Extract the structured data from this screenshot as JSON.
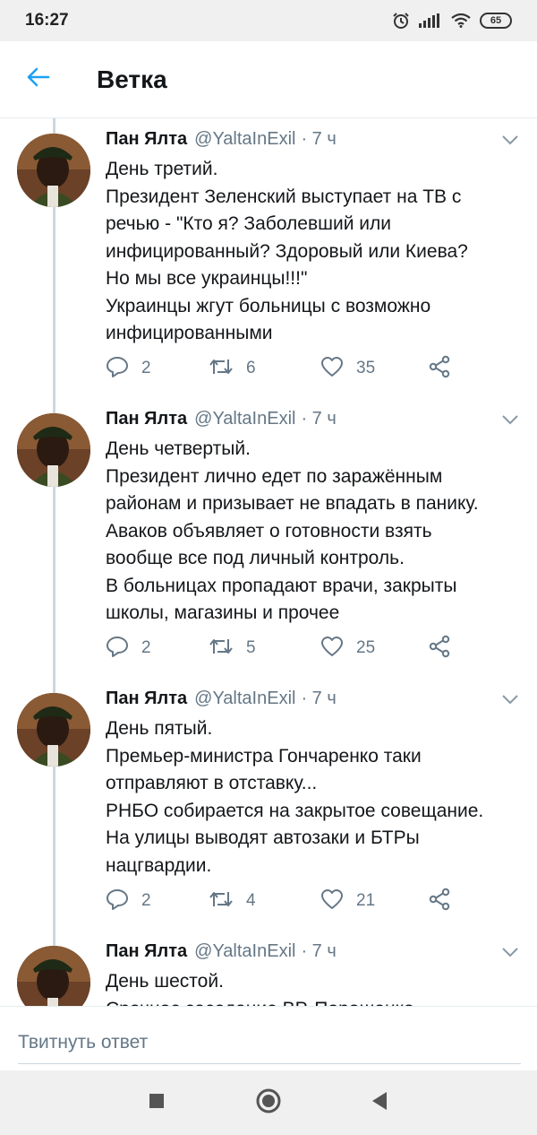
{
  "status_bar": {
    "time": "16:27",
    "battery": "65",
    "icons": [
      "alarm-icon",
      "signal-icon",
      "wifi-icon",
      "battery-icon"
    ]
  },
  "header": {
    "title": "Ветка",
    "back_icon": "arrow-left-icon"
  },
  "colors": {
    "accent": "#1da1f2",
    "secondary_text": "#657786",
    "thread_line": "#ccd6dd"
  },
  "tweets": [
    {
      "name": "Пан Ялта",
      "handle": "@YaltaInExil",
      "time": "· 7 ч",
      "lines": [
        "День третий.",
        "Президент Зеленский выступает на ТВ с",
        "речью - \"Кто я? Заболевший или",
        "инфицированный? Здоровый или Киева?",
        "Но мы все украинцы!!!\"",
        "Украинцы жгут больницы с возможно",
        "инфицированными"
      ],
      "replies": "2",
      "retweets": "6",
      "likes": "35"
    },
    {
      "name": "Пан Ялта",
      "handle": "@YaltaInExil",
      "time": "· 7 ч",
      "lines": [
        "День четвертый.",
        "Президент лично едет по заражённым",
        "районам и призывает не впадать в панику.",
        "Аваков объявляет о готовности взять",
        "вообще все под личный контроль.",
        "В больницах пропадают врачи, закрыты",
        "школы, магазины и прочее"
      ],
      "replies": "2",
      "retweets": "5",
      "likes": "25"
    },
    {
      "name": "Пан Ялта",
      "handle": "@YaltaInExil",
      "time": "· 7 ч",
      "lines": [
        "День пятый.",
        "Премьер-министра Гончаренко таки",
        "отправляют в отставку...",
        "РНБО собирается на закрытое совещание.",
        "На улицы выводят автозаки и БТРы",
        "нацгвардии."
      ],
      "replies": "2",
      "retweets": "4",
      "likes": "21"
    },
    {
      "name": "Пан Ялта",
      "handle": "@YaltaInExil",
      "time": "· 7 ч",
      "lines": [
        "День шестой.",
        "Срочное заседание ВР. Порошенко"
      ]
    }
  ],
  "compose": {
    "placeholder": "Твитнуть ответ"
  },
  "nav_bar": {
    "icons": [
      "recents-square-icon",
      "home-circle-icon",
      "back-triangle-icon"
    ]
  }
}
